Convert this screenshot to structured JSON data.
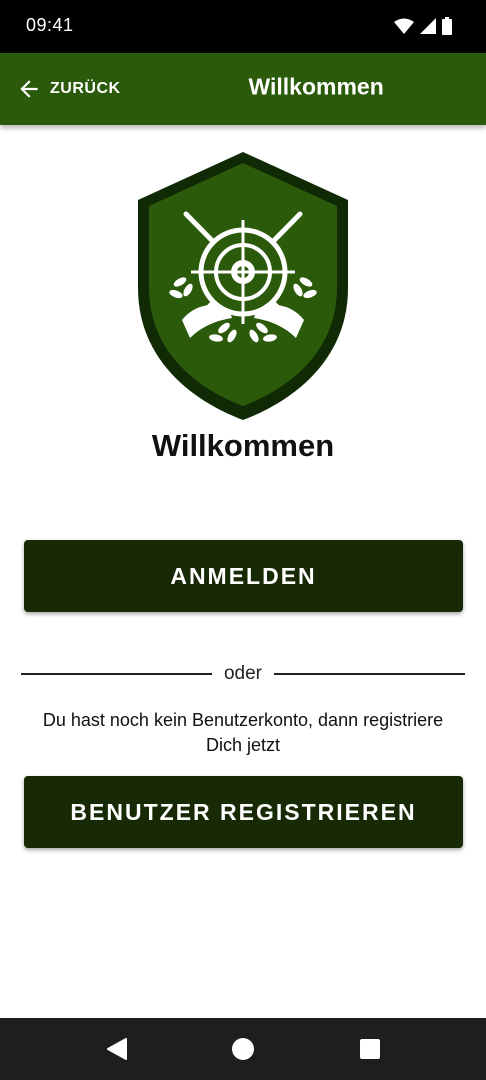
{
  "status_bar": {
    "time": "09:41",
    "icons": [
      "wifi-icon",
      "signal-icon",
      "battery-icon"
    ]
  },
  "app_bar": {
    "back_label": "ZURÜCK",
    "title": "Willkommen",
    "color": "#2b5a0a"
  },
  "logo": {
    "icon": "shield-target-crest-icon",
    "shield_dark": "#0f2a04",
    "shield_fill": "#2b5a0a"
  },
  "main": {
    "heading": "Willkommen",
    "login_button": "ANMELDEN",
    "divider_text": "oder",
    "info_text": "Du hast noch kein Benutzerkonto, dann registriere Dich jetzt",
    "register_button": "BENUTZER REGISTRIEREN",
    "button_color": "#172a05"
  },
  "nav_bar": {
    "icons": [
      "back-triangle-icon",
      "home-circle-icon",
      "recents-square-icon"
    ]
  }
}
